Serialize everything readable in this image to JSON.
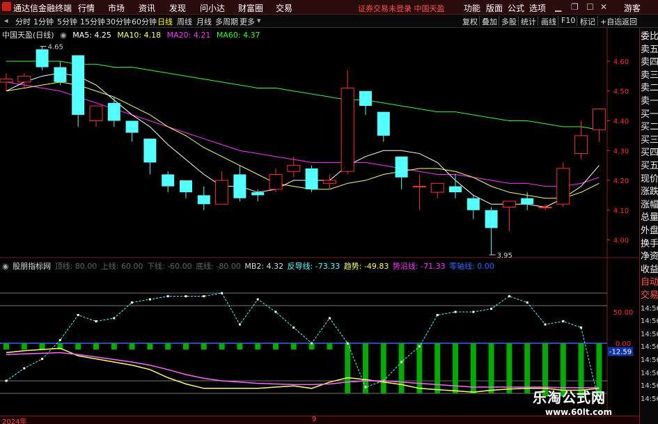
{
  "titlebar": {
    "app_name": "通达信金融终端",
    "menus": [
      "行情",
      "市场",
      "资讯",
      "发现",
      "问小达",
      "财富圈",
      "交易"
    ],
    "notice": "证券交易未登录",
    "notice_stock": "中国天盈",
    "right": [
      "功能",
      "版面",
      "公式",
      "选项"
    ],
    "guest": "游客"
  },
  "toolbar": {
    "periods": [
      "分时",
      "1分钟",
      "5分钟",
      "15分钟",
      "30分钟",
      "60分钟",
      "日线",
      "周线",
      "月线",
      "多周期",
      "更多"
    ],
    "active_period": "日线",
    "tools": [
      "复权",
      "叠加",
      "多股",
      "统计",
      "画线",
      "F10",
      "标记",
      "+自选",
      "返回"
    ]
  },
  "main_legend": {
    "stock": "中国天盈(日线)",
    "ma5": "MA5: 4.25",
    "ma10": "MA10: 4.18",
    "ma20": "MA20: 4.21",
    "ma60": "MA60: 4.37"
  },
  "price_axis": [
    "4.60",
    "4.50",
    "4.40",
    "4.30",
    "4.20",
    "4.10",
    "4.00"
  ],
  "annotations": {
    "high": "4.65",
    "low": "3.95"
  },
  "indicator_legend": {
    "name": "股朋指标网",
    "l1": "顶线: 80.00",
    "l2": "上线: 60.00",
    "l3": "下线: -60.00",
    "l4": "底线: -80.00",
    "mb2": "MB2: 4.32",
    "fd": "反导线: -73.33",
    "qs": "趋势: -49.83",
    "sy": "势沿线: -71.33",
    "zero": "零轴线: 0.00"
  },
  "indicator_axis": [
    "50.00",
    "0.00"
  ],
  "indicator_value": "-12.59",
  "right_panel": [
    "委比",
    "卖五",
    "卖四",
    "卖三",
    "卖二",
    "卖一",
    "买一",
    "买二",
    "买三",
    "买四",
    "买五",
    "现价",
    "涨跌",
    "涨幅",
    "总量",
    "外盘",
    "换手",
    "净资",
    "收益",
    "自动",
    "交易",
    "14:56",
    "14:56",
    "14:56",
    "14:56",
    "14:56",
    "14:56",
    "14:56",
    "14:56"
  ],
  "bottom": {
    "year": "2024年",
    "month_mark": "9"
  },
  "watermark": {
    "line1": "乐淘公式网",
    "line2": "www.60lt.com"
  },
  "colors": {
    "up": "#ff3030",
    "down": "#54ffff",
    "ma5": "#ffffff",
    "ma10": "#ffff66",
    "ma20": "#ff33ff",
    "ma60": "#33ff33"
  },
  "chart_data": {
    "type": "candlestick",
    "price_range": [
      3.95,
      4.67
    ],
    "candles": [
      {
        "o": 4.53,
        "h": 4.56,
        "l": 4.5,
        "c": 4.54
      },
      {
        "o": 4.53,
        "h": 4.56,
        "l": 4.51,
        "c": 4.55
      },
      {
        "o": 4.64,
        "h": 4.65,
        "l": 4.57,
        "c": 4.58
      },
      {
        "o": 4.58,
        "h": 4.6,
        "l": 4.52,
        "c": 4.53
      },
      {
        "o": 4.62,
        "h": 4.62,
        "l": 4.38,
        "c": 4.42
      },
      {
        "o": 4.4,
        "h": 4.45,
        "l": 4.38,
        "c": 4.45
      },
      {
        "o": 4.46,
        "h": 4.48,
        "l": 4.38,
        "c": 4.4
      },
      {
        "o": 4.4,
        "h": 4.4,
        "l": 4.33,
        "c": 4.36
      },
      {
        "o": 4.34,
        "h": 4.34,
        "l": 4.22,
        "c": 4.26
      },
      {
        "o": 4.22,
        "h": 4.23,
        "l": 4.16,
        "c": 4.18
      },
      {
        "o": 4.2,
        "h": 4.2,
        "l": 4.14,
        "c": 4.16
      },
      {
        "o": 4.15,
        "h": 4.18,
        "l": 4.1,
        "c": 4.12
      },
      {
        "o": 4.12,
        "h": 4.23,
        "l": 4.12,
        "c": 4.2
      },
      {
        "o": 4.22,
        "h": 4.25,
        "l": 4.13,
        "c": 4.14
      },
      {
        "o": 4.16,
        "h": 4.17,
        "l": 4.13,
        "c": 4.15
      },
      {
        "o": 4.17,
        "h": 4.24,
        "l": 4.16,
        "c": 4.22
      },
      {
        "o": 4.23,
        "h": 4.28,
        "l": 4.21,
        "c": 4.25
      },
      {
        "o": 4.24,
        "h": 4.25,
        "l": 4.16,
        "c": 4.17
      },
      {
        "o": 4.19,
        "h": 4.22,
        "l": 4.17,
        "c": 4.2
      },
      {
        "o": 4.23,
        "h": 4.57,
        "l": 4.22,
        "c": 4.51
      },
      {
        "o": 4.5,
        "h": 4.5,
        "l": 4.42,
        "c": 4.45
      },
      {
        "o": 4.43,
        "h": 4.43,
        "l": 4.33,
        "c": 4.35
      },
      {
        "o": 4.28,
        "h": 4.28,
        "l": 4.17,
        "c": 4.21
      },
      {
        "o": 4.18,
        "h": 4.22,
        "l": 4.1,
        "c": 4.18
      },
      {
        "o": 4.16,
        "h": 4.19,
        "l": 4.14,
        "c": 4.19
      },
      {
        "o": 4.18,
        "h": 4.22,
        "l": 4.14,
        "c": 4.16
      },
      {
        "o": 4.14,
        "h": 4.15,
        "l": 4.07,
        "c": 4.1
      },
      {
        "o": 4.1,
        "h": 4.11,
        "l": 3.95,
        "c": 4.04
      },
      {
        "o": 4.11,
        "h": 4.12,
        "l": 4.03,
        "c": 4.13
      },
      {
        "o": 4.14,
        "h": 4.16,
        "l": 4.1,
        "c": 4.12
      },
      {
        "o": 4.11,
        "h": 4.12,
        "l": 4.1,
        "c": 4.11
      },
      {
        "o": 4.12,
        "h": 4.26,
        "l": 4.11,
        "c": 4.24
      },
      {
        "o": 4.29,
        "h": 4.4,
        "l": 4.27,
        "c": 4.35
      },
      {
        "o": 4.37,
        "h": 4.44,
        "l": 4.33,
        "c": 4.44
      }
    ],
    "ma5": [
      4.5,
      4.53,
      4.55,
      4.56,
      4.55,
      4.52,
      4.47,
      4.42,
      4.38,
      4.32,
      4.27,
      4.22,
      4.18,
      4.18,
      4.16,
      4.17,
      4.2,
      4.2,
      4.2,
      4.25,
      4.28,
      4.3,
      4.3,
      4.29,
      4.26,
      4.2,
      4.15,
      4.12,
      4.12,
      4.12,
      4.11,
      4.14,
      4.18,
      4.25
    ],
    "ma10": [
      4.5,
      4.51,
      4.52,
      4.53,
      4.52,
      4.5,
      4.48,
      4.45,
      4.42,
      4.38,
      4.35,
      4.31,
      4.28,
      4.25,
      4.22,
      4.19,
      4.18,
      4.17,
      4.17,
      4.19,
      4.2,
      4.22,
      4.23,
      4.24,
      4.24,
      4.23,
      4.21,
      4.18,
      4.16,
      4.15,
      4.14,
      4.14,
      4.16,
      4.19
    ],
    "ma20": [
      4.53,
      4.52,
      4.51,
      4.5,
      4.48,
      4.46,
      4.44,
      4.42,
      4.4,
      4.38,
      4.36,
      4.34,
      4.32,
      4.3,
      4.29,
      4.28,
      4.27,
      4.26,
      4.26,
      4.26,
      4.26,
      4.25,
      4.24,
      4.23,
      4.22,
      4.22,
      4.21,
      4.2,
      4.19,
      4.19,
      4.18,
      4.18,
      4.19,
      4.21
    ],
    "ma60": [
      4.6,
      4.6,
      4.6,
      4.6,
      4.59,
      4.59,
      4.58,
      4.58,
      4.57,
      4.56,
      4.55,
      4.54,
      4.53,
      4.52,
      4.51,
      4.51,
      4.5,
      4.49,
      4.48,
      4.47,
      4.47,
      4.46,
      4.45,
      4.44,
      4.43,
      4.43,
      4.42,
      4.41,
      4.4,
      4.4,
      4.39,
      4.38,
      4.38,
      4.37
    ],
    "indicator_range": [
      -110,
      120
    ],
    "indicator_levels": [
      80,
      60,
      -60,
      -80
    ],
    "indicator_dashed": [
      -60,
      -40,
      -25,
      5,
      45,
      35,
      40,
      65,
      70,
      75,
      75,
      75,
      80,
      30,
      70,
      50,
      25,
      0,
      40,
      0,
      -70,
      -60,
      -30,
      -5,
      45,
      50,
      50,
      55,
      75,
      65,
      30,
      35,
      25,
      -95
    ],
    "indicator_bars": [
      -10,
      -10,
      -10,
      -10,
      -10,
      -10,
      -10,
      -10,
      -10,
      -10,
      -10,
      -10,
      -10,
      -10,
      -10,
      -10,
      -10,
      -10,
      -10,
      -80,
      -80,
      -80,
      -80,
      -80,
      -80,
      -80,
      -80,
      -80,
      -80,
      -80,
      -85,
      -85,
      -85,
      -85
    ],
    "indicator_trend": [
      -15,
      -12,
      -10,
      -8,
      -20,
      -25,
      -30,
      -35,
      -42,
      -55,
      -65,
      -72,
      -72,
      -72,
      -72,
      -70,
      -68,
      -72,
      -62,
      -55,
      -58,
      -62,
      -66,
      -72,
      -74,
      -76,
      -78,
      -75,
      -73,
      -72,
      -72,
      -75,
      -75,
      -72
    ],
    "indicator_edge": [
      -18,
      -17,
      -16,
      -15,
      -18,
      -22,
      -26,
      -30,
      -35,
      -42,
      -50,
      -56,
      -60,
      -62,
      -64,
      -65,
      -66,
      -66,
      -65,
      -62,
      -60,
      -60,
      -62,
      -64,
      -66,
      -68,
      -70,
      -70,
      -70,
      -70,
      -70,
      -71,
      -71,
      -71
    ]
  }
}
